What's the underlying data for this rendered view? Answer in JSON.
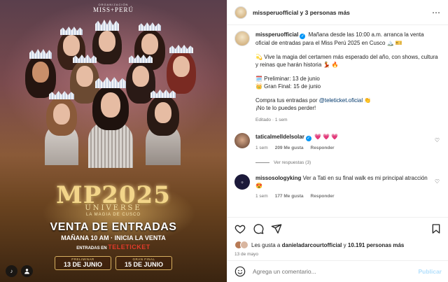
{
  "post_image": {
    "brand_small": "ORGANIZACIÓN",
    "brand_name": "MISS+PERÚ",
    "logo_text": "MP2025",
    "logo_sub": "UNIVERSE",
    "tagline": "LA MAGIA DE CUSCO",
    "headline": "VENTA DE ENTRADAS",
    "subheadline": "MAÑANA 10 AM · INICIA LA VENTA",
    "entradas_label": "ENTRADAS EN",
    "ticketer": "TELETICKET",
    "prelim_label": "PRELIMINAR",
    "prelim_date": "13 DE JUNIO",
    "final_label": "GRAN FINAL",
    "final_date": "15 DE JUNIO"
  },
  "header": {
    "title": "missperuofficial y 3 personas más",
    "more_icon": "⋯"
  },
  "caption": {
    "username": "missperuofficial",
    "line1": "Mañana desde las 10:00 a.m. arranca la venta oficial de entradas para el Miss Perú 2025 en Cusco 🏔️ 🎫",
    "line2": "💫 Vive la magia del certamen más esperado del año, con shows, cultura y reinas que harán historia 💃 🔥",
    "prelim": "🗓️ Preliminar: 13 de junio",
    "final": "👑 Gran Final: 15 de junio",
    "buy_prefix": "Compra tus entradas por",
    "buy_link": "@teleticket.oficial",
    "buy_suffix": "👏",
    "closing": "¡No te lo puedes perder!",
    "meta": "Editado · 1 sem"
  },
  "comments": [
    {
      "username": "taticalmelldelsolar",
      "text": "💗 💗 💗",
      "time": "1 sem",
      "likes": "209 Me gusta",
      "reply": "Responder",
      "replies": "Ver respuestas (3)"
    },
    {
      "username": "missosologyking",
      "text": "Ver a Tati en su final walk es mi principal atracción 😍",
      "time": "1 sem",
      "likes": "177 Me gusta",
      "reply": "Responder"
    }
  ],
  "likes": {
    "prefix": "Les gusta a",
    "user": "danieladarcourtofficial",
    "middle": "y",
    "count": "10.191 personas más"
  },
  "date": "13 de mayo",
  "add_comment": {
    "placeholder": "Agrega un comentario...",
    "publish": "Publicar"
  }
}
